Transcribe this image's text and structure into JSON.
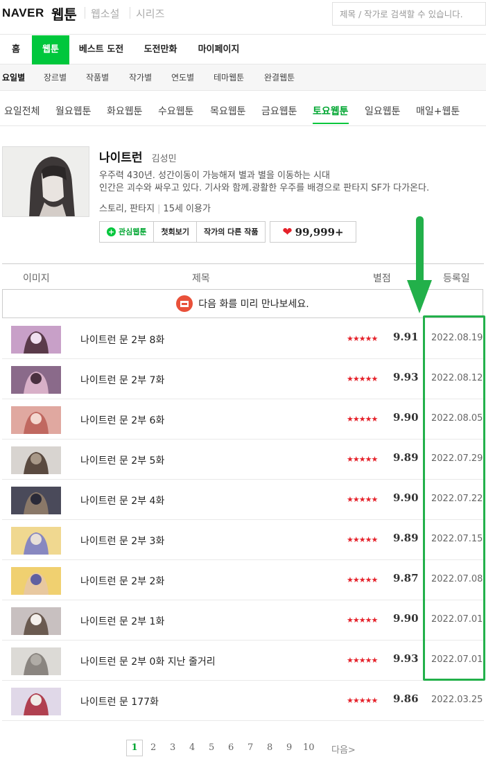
{
  "header": {
    "logo_naver": "NAVER",
    "logo_webtoon": "웹툰",
    "links": [
      "웹소설",
      "시리즈"
    ],
    "search_placeholder": "제목 / 작가로 검색할 수 있습니다."
  },
  "main_nav": [
    "홈",
    "웹툰",
    "베스트 도전",
    "도전만화",
    "마이페이지"
  ],
  "main_nav_active": "웹툰",
  "sub_nav": [
    "요일별",
    "장르별",
    "작품별",
    "작가별",
    "연도별",
    "테마웹툰",
    "완결웹툰"
  ],
  "sub_nav_active": "요일별",
  "day_tabs": [
    "요일전체",
    "월요웹툰",
    "화요웹툰",
    "수요웹툰",
    "목요웹툰",
    "금요웹툰",
    "토요웹툰",
    "일요웹툰",
    "매일+웹툰"
  ],
  "day_tab_active": "토요웹툰",
  "comic": {
    "title": "나이트런",
    "author": "김성민",
    "desc_line1": "우주력 430년. 성간이동이 가능해져 별과 별을 이동하는 시대",
    "desc_line2": "인간은 괴수와 싸우고 있다. 기사와 함께.광활한 우주를 배경으로 판타지 SF가 다가온다.",
    "genre": "스토리, 판타지",
    "age": "15세 이용가",
    "buttons": {
      "favorite": "관심웹툰",
      "first": "첫회보기",
      "other": "작가의 다른 작품"
    },
    "likes": "99,999+"
  },
  "table": {
    "headers": {
      "image": "이미지",
      "title": "제목",
      "rating": "별점",
      "date": "등록일"
    },
    "preview_text": "다음 화를 미리 만나보세요.",
    "rows": [
      {
        "title": "나이트런 문 2부 8화",
        "stars": "★★★★★",
        "score": "9.91",
        "date": "2022.08.19"
      },
      {
        "title": "나이트런 문 2부 7화",
        "stars": "★★★★★",
        "score": "9.93",
        "date": "2022.08.12"
      },
      {
        "title": "나이트런 문 2부 6화",
        "stars": "★★★★★",
        "score": "9.90",
        "date": "2022.08.05"
      },
      {
        "title": "나이트런 문 2부 5화",
        "stars": "★★★★★",
        "score": "9.89",
        "date": "2022.07.29"
      },
      {
        "title": "나이트런 문 2부 4화",
        "stars": "★★★★★",
        "score": "9.90",
        "date": "2022.07.22"
      },
      {
        "title": "나이트런 문 2부 3화",
        "stars": "★★★★★",
        "score": "9.89",
        "date": "2022.07.15"
      },
      {
        "title": "나이트런 문 2부 2화",
        "stars": "★★★★★",
        "score": "9.87",
        "date": "2022.07.08"
      },
      {
        "title": "나이트런 문 2부 1화",
        "stars": "★★★★★",
        "score": "9.90",
        "date": "2022.07.01"
      },
      {
        "title": "나이트런 문 2부 0화 지난 줄거리",
        "stars": "★★★★★",
        "score": "9.93",
        "date": "2022.07.01"
      },
      {
        "title": "나이트런 문 177화",
        "stars": "★★★★★",
        "score": "9.86",
        "date": "2022.03.25"
      }
    ]
  },
  "pagination": {
    "pages": [
      "1",
      "2",
      "3",
      "4",
      "5",
      "6",
      "7",
      "8",
      "9",
      "10"
    ],
    "current": "1",
    "next": "다음"
  },
  "colors": {
    "accent_green": "#00c73c",
    "annotation_green": "#22b04a",
    "star_red": "#e5212a"
  }
}
